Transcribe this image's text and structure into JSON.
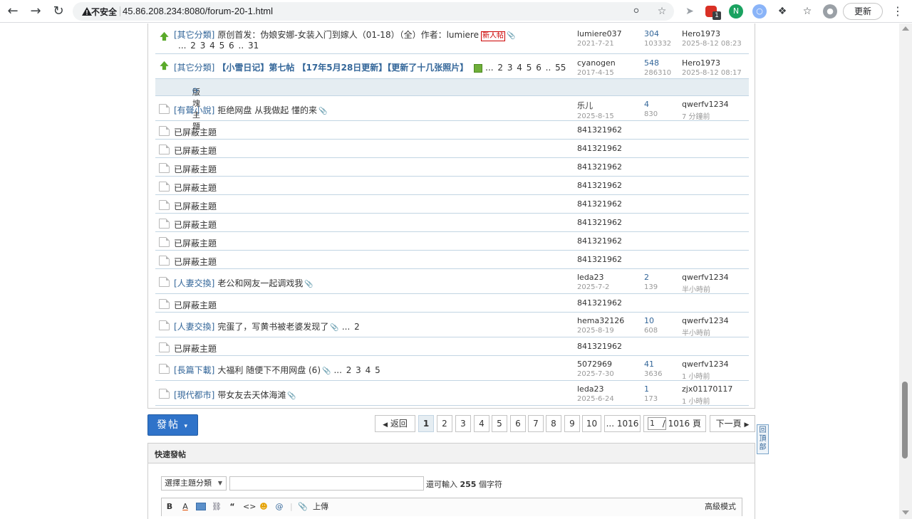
{
  "browser": {
    "insecure_label": "不安全",
    "url": "45.86.208.234:8080/forum-20-1.html",
    "update_label": "更新",
    "ext_badge": "1"
  },
  "threads_top": [
    {
      "cat": "[其它分類]",
      "title": "原创首发：伪娘安娜-女装入门到嫁人（01-18）（全）作者：lumiere",
      "tag": "新人帖",
      "pages": "... 2 3 4 5 6 .. 31",
      "author": "lumiere037",
      "date": "2021-7-21",
      "replies": "304",
      "views": "103332",
      "last_user": "Hero1973",
      "last_date": "2025-8-12 08:23"
    },
    {
      "cat": "[其它分類]",
      "title": "【小雪日记】第七帖 【17年5月28日更新】【更新了十几张照片】",
      "pages": "... 2 3 4 5 6 .. 55",
      "author": "cyanogen",
      "date": "2017-4-15",
      "replies": "548",
      "views": "286310",
      "last_user": "Hero1973",
      "last_date": "2025-8-12 08:17"
    }
  ],
  "section_label": "版塊主題",
  "threads": [
    {
      "cat": "[有聲小說]",
      "title": "拒绝网盘 从我做起 懂的来",
      "author": "乐儿",
      "date": "2025-8-15",
      "replies": "4",
      "views": "830",
      "last_user": "qwerfv1234",
      "last_date": "7 分鐘前"
    },
    {
      "blocked": "已屏蔽主題",
      "author": "841321962"
    },
    {
      "blocked": "已屏蔽主題",
      "author": "841321962"
    },
    {
      "blocked": "已屏蔽主題",
      "author": "841321962"
    },
    {
      "blocked": "已屏蔽主題",
      "author": "841321962"
    },
    {
      "blocked": "已屏蔽主題",
      "author": "841321962"
    },
    {
      "blocked": "已屏蔽主題",
      "author": "841321962"
    },
    {
      "blocked": "已屏蔽主題",
      "author": "841321962"
    },
    {
      "blocked": "已屏蔽主題",
      "author": "841321962"
    },
    {
      "cat": "[人妻交換]",
      "title": "老公和网友一起调戏我",
      "author": "leda23",
      "date": "2025-7-2",
      "replies": "2",
      "views": "139",
      "last_user": "qwerfv1234",
      "last_date": "半小時前"
    },
    {
      "blocked": "已屏蔽主題",
      "author": "841321962"
    },
    {
      "cat": "[人妻交換]",
      "title": "完蛋了，写黄书被老婆发现了",
      "pages": "... 2",
      "author": "hema32126",
      "date": "2025-8-19",
      "replies": "10",
      "views": "608",
      "last_user": "qwerfv1234",
      "last_date": "半小時前"
    },
    {
      "blocked": "已屏蔽主題",
      "author": "841321962"
    },
    {
      "cat": "[長篇下載]",
      "title": "大福利 随便下不用网盘 (6)",
      "pages": "... 2 3 4 5",
      "author": "5072969",
      "date": "2025-7-30",
      "replies": "41",
      "views": "3636",
      "last_user": "qwerfv1234",
      "last_date": "1 小時前"
    },
    {
      "cat": "[現代都市]",
      "title": "带女友去天体海滩",
      "author": "leda23",
      "date": "2025-6-24",
      "replies": "1",
      "views": "173",
      "last_user": "zjx01170117",
      "last_date": "1 小時前"
    }
  ],
  "pagination": {
    "post_button": "發帖",
    "back": "返回",
    "pages": [
      "1",
      "2",
      "3",
      "4",
      "5",
      "6",
      "7",
      "8",
      "9",
      "10"
    ],
    "last": "... 1016",
    "input_value": "1",
    "total": "/ 1016 頁",
    "next": "下一頁",
    "back_to_top": "回頂部"
  },
  "quick_post": {
    "title": "快速發帖",
    "type_select": "選擇主題分類",
    "remain_prefix": "還可輸入",
    "remain_count": "255",
    "remain_suffix": "個字符",
    "upload": "上傳",
    "advanced": "高級模式"
  }
}
